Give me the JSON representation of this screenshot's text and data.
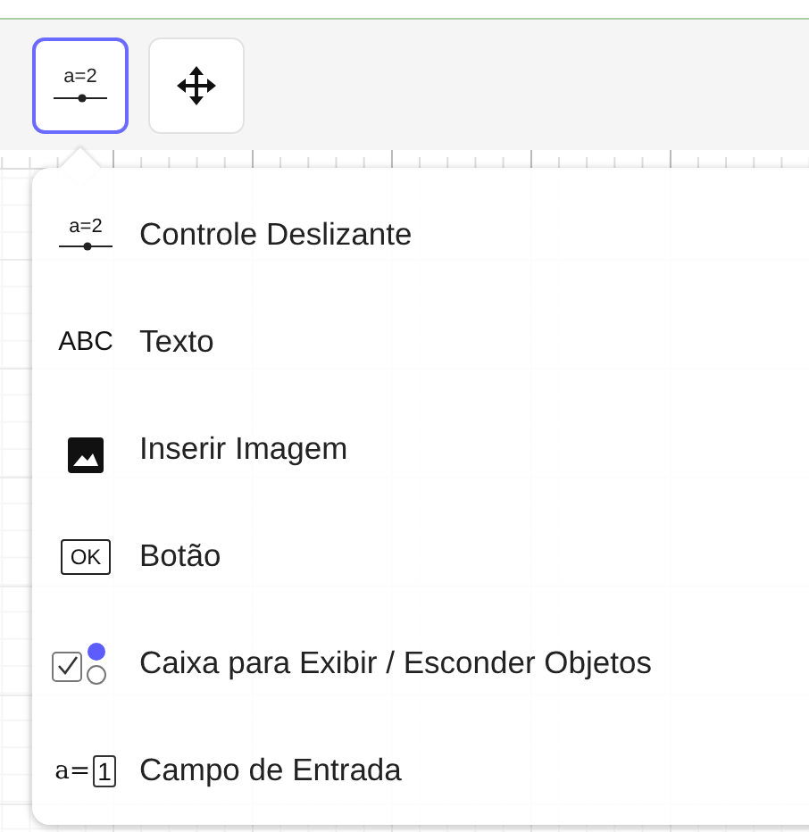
{
  "toolbar": {
    "tools": [
      {
        "kind": "slider",
        "icon_text": "a=2",
        "selected": true
      },
      {
        "kind": "move",
        "selected": false
      }
    ]
  },
  "menu": {
    "items": [
      {
        "kind": "slider",
        "icon_text": "a=2",
        "label": "Controle Deslizante"
      },
      {
        "kind": "text",
        "icon_text": "ABC",
        "label": "Texto"
      },
      {
        "kind": "image",
        "label": "Inserir Imagem"
      },
      {
        "kind": "button",
        "icon_text": "OK",
        "label": "Botão"
      },
      {
        "kind": "checkbox",
        "label": "Caixa para Exibir / Esconder Objetos"
      },
      {
        "kind": "input",
        "icon_label": "a=",
        "icon_value": "1",
        "label": "Campo de Entrada"
      }
    ]
  }
}
